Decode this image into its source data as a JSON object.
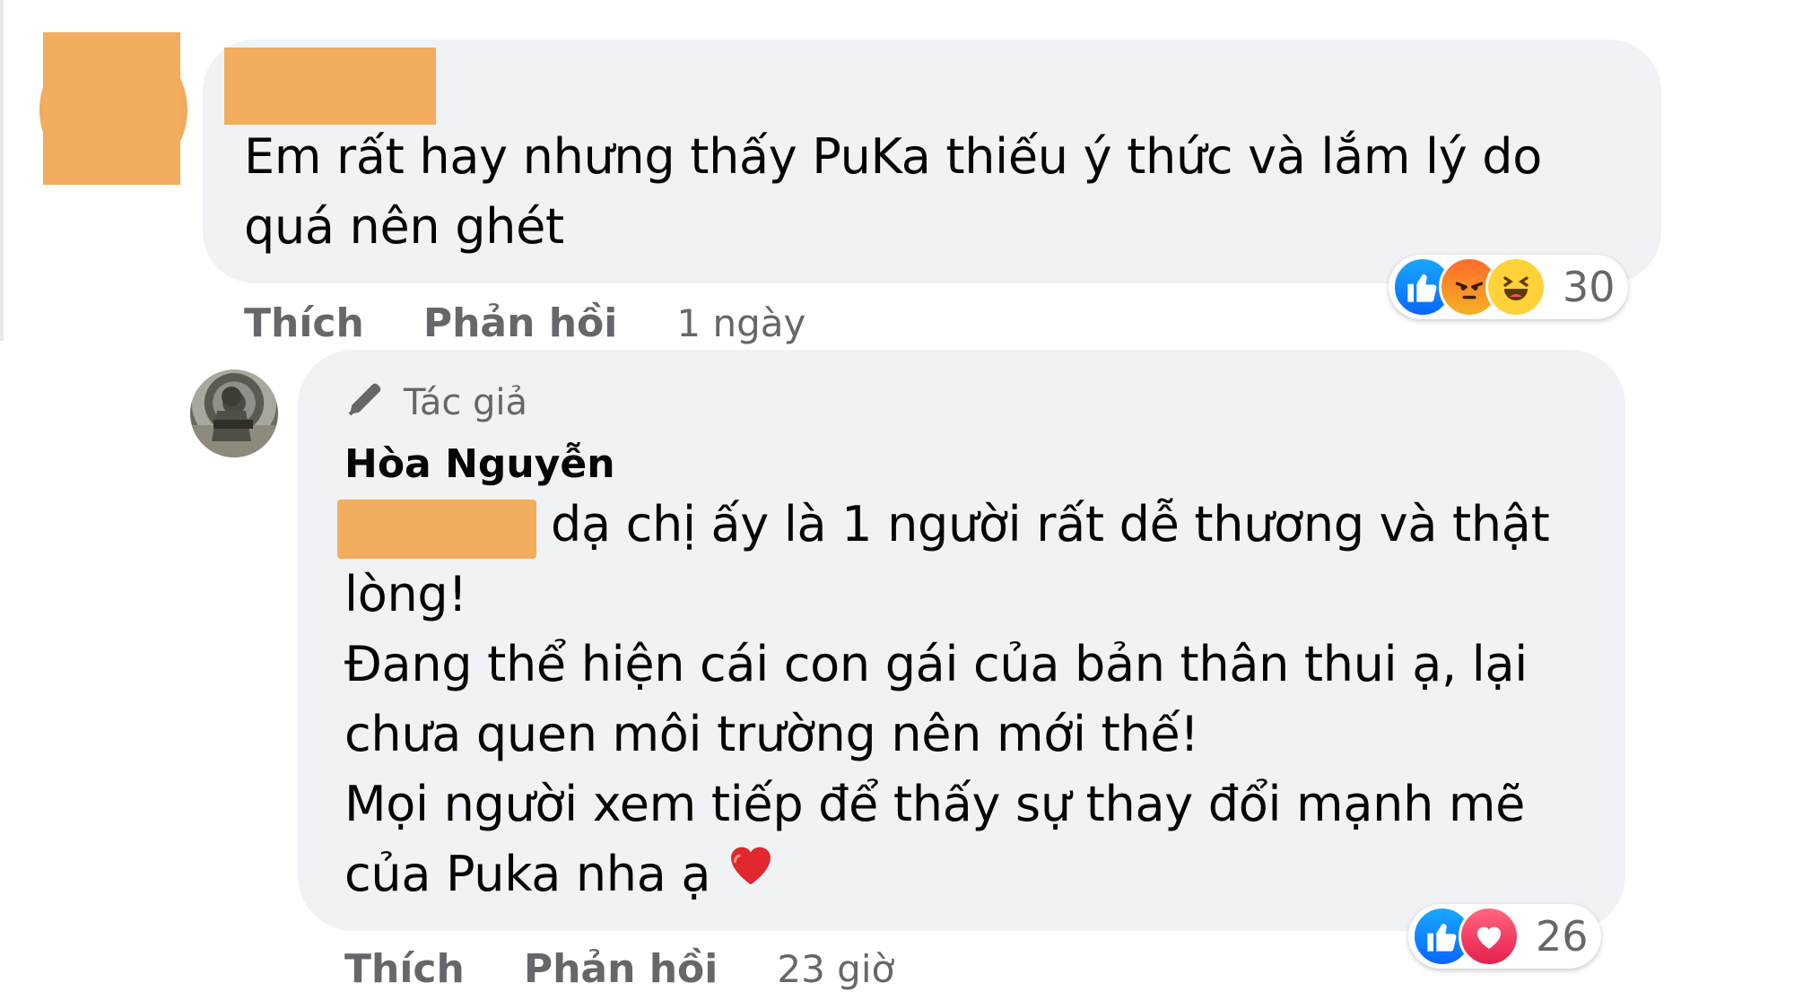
{
  "comments": [
    {
      "text": "Em rất hay nhưng thấy PuKa thiếu ý thức và lắm lý do\nquá nên ghét",
      "actions": {
        "like": "Thích",
        "reply": "Phản hồi",
        "time": "1 ngày"
      },
      "reactions": {
        "icons": [
          "like-icon",
          "angry-icon",
          "haha-icon"
        ],
        "count": "30"
      }
    },
    {
      "author_badge": "Tác giả",
      "author": "Hòa Nguyễn",
      "text_first_line": "dạ chị ấy là 1 người rất dễ thương và thật",
      "text_rest": "lòng!\nĐang thể hiện cái con gái của bản thân thui ạ, lại\nchưa quen môi trường nên mới thế!\nMọi người xem tiếp để thấy sự thay đổi mạnh mẽ\ncủa Puka nha ạ",
      "emoji": "heart-icon",
      "actions": {
        "like": "Thích",
        "reply": "Phản hồi",
        "time": "23 giờ"
      },
      "reactions": {
        "icons": [
          "like-icon",
          "love-icon"
        ],
        "count": "26"
      }
    }
  ],
  "colors": {
    "bubble": "#f0f2f5",
    "redaction": "#f2ad5f",
    "secondary_text": "#65676b",
    "like_blue": "#0866ff",
    "heart_red": "#e61e4d"
  }
}
